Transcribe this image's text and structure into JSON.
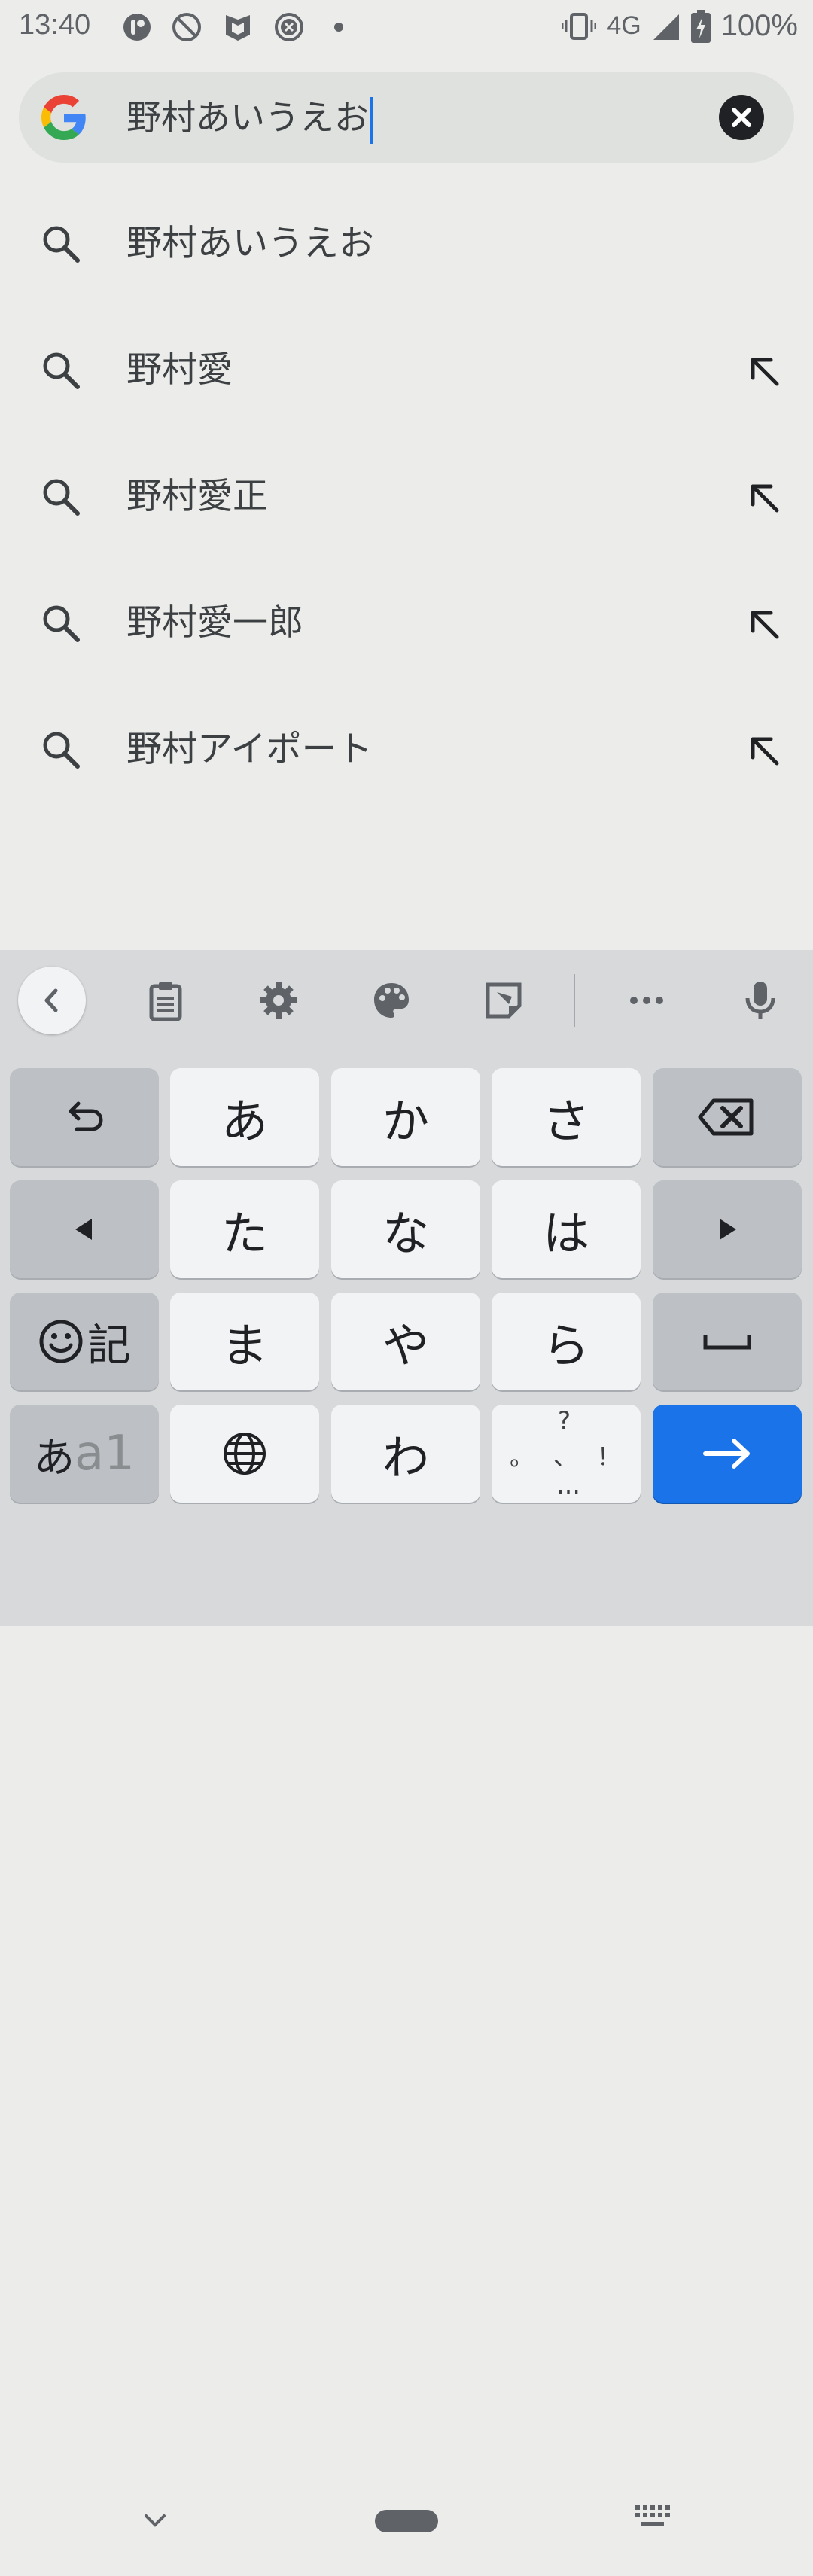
{
  "status_bar": {
    "time": "13:40",
    "network": "4G",
    "battery": "100%",
    "left_icons": [
      "app-icon",
      "no-disturb-icon",
      "shield-icon",
      "cancel-circle-icon",
      "dot-icon"
    ],
    "right_icons": [
      "vibrate-icon",
      "signal-icon",
      "battery-charging-icon"
    ]
  },
  "search": {
    "query": "野村あいうえお",
    "logo": "google-g-logo",
    "clear_icon": "close-circle-icon"
  },
  "suggestions": [
    {
      "text": "野村あいうえお",
      "fill_arrow": false
    },
    {
      "text": "野村愛",
      "fill_arrow": true
    },
    {
      "text": "野村愛正",
      "fill_arrow": true
    },
    {
      "text": "野村愛一郎",
      "fill_arrow": true
    },
    {
      "text": "野村アイポート",
      "fill_arrow": true
    }
  ],
  "keyboard": {
    "toolbar_icons": [
      "chevron-left-icon",
      "clipboard-icon",
      "gear-icon",
      "palette-icon",
      "sticker-icon",
      "more-icon",
      "mic-icon"
    ],
    "rows": [
      [
        "undo-icon",
        "あ",
        "か",
        "さ",
        "backspace-icon"
      ],
      [
        "left-arrow-icon",
        "た",
        "な",
        "は",
        "right-arrow-icon"
      ],
      [
        "emoji-記",
        "ま",
        "や",
        "ら",
        "space-icon"
      ],
      [
        "あa1",
        "globe-icon",
        "わ",
        "punct",
        "enter-arrow-icon"
      ]
    ],
    "emoji_label": "記",
    "mode_label_kana": "あ",
    "mode_label_alpha": "a1",
    "punct_top": "?",
    "punct_left": "。",
    "punct_mid": "、",
    "punct_right": "！",
    "punct_bottom": "…",
    "accent_color": "#1a73e8"
  },
  "nav": {
    "icons": [
      "chevron-down-icon",
      "home-pill",
      "keyboard-switch-icon"
    ]
  }
}
